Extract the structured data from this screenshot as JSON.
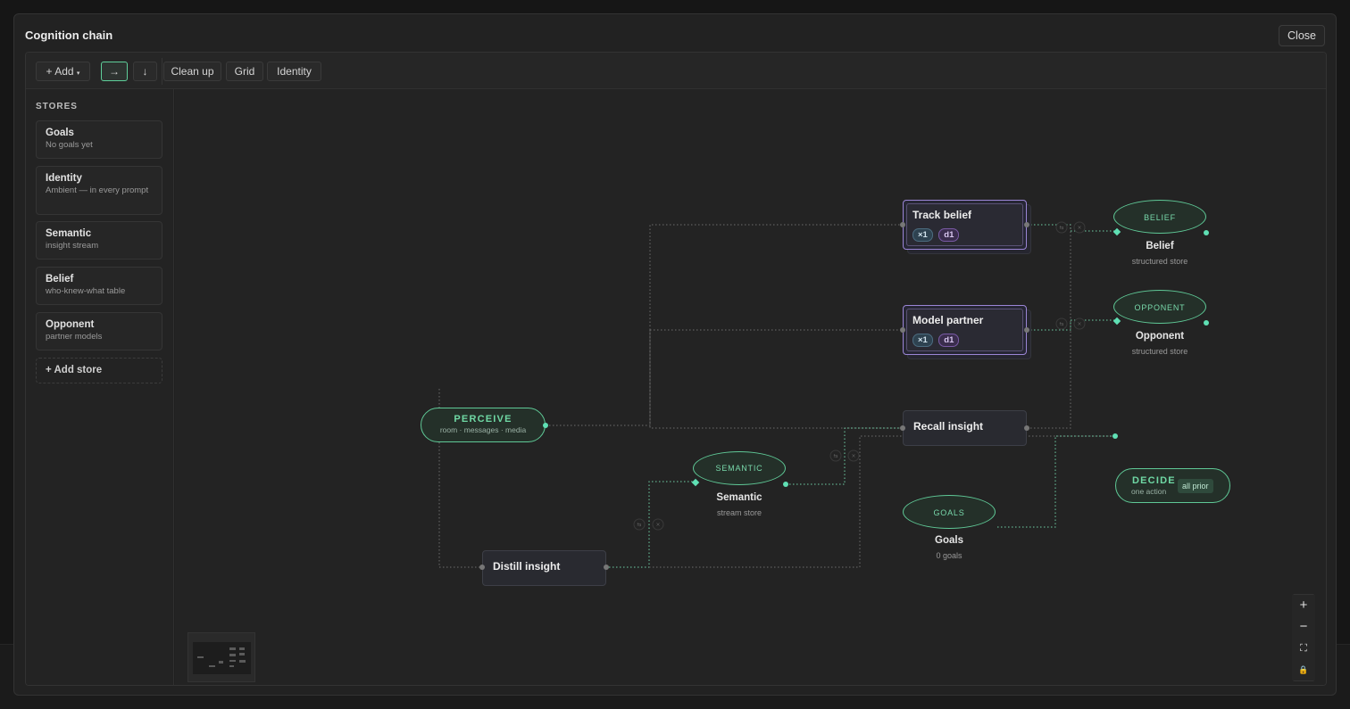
{
  "window": {
    "title": "Cognition chain",
    "close_label": "Close"
  },
  "toolbar": {
    "add_label": "+ Add",
    "add_caret": "▾",
    "dir_right": "→",
    "dir_down": "↓",
    "cleanup_label": "Clean up",
    "grid_label": "Grid",
    "identity_label": "Identity"
  },
  "sidebar": {
    "heading": "STORES",
    "stores": [
      {
        "name": "Goals",
        "sub": "No goals yet"
      },
      {
        "name": "Identity",
        "sub": "Ambient — in every prompt"
      },
      {
        "name": "Semantic",
        "sub": "insight stream"
      },
      {
        "name": "Belief",
        "sub": "who-knew-what table"
      },
      {
        "name": "Opponent",
        "sub": "partner models"
      }
    ],
    "add_store_label": "+ Add store"
  },
  "graph": {
    "perceive": {
      "title": "PERCEIVE",
      "sub": "room · messages · media"
    },
    "distill": {
      "title": "Distill insight"
    },
    "recall": {
      "title": "Recall insight"
    },
    "track_belief": {
      "title": "Track belief",
      "chip_x": "×1",
      "chip_d": "d1"
    },
    "model_partner": {
      "title": "Model partner",
      "chip_x": "×1",
      "chip_d": "d1"
    },
    "semantic": {
      "pill": "SEMANTIC",
      "name": "Semantic",
      "sub": "stream store"
    },
    "belief": {
      "pill": "BELIEF",
      "name": "Belief",
      "sub": "structured store"
    },
    "opponent": {
      "pill": "OPPONENT",
      "name": "Opponent",
      "sub": "structured store"
    },
    "goals": {
      "pill": "GOALS",
      "name": "Goals",
      "sub": "0 goals"
    },
    "decide": {
      "title": "DECIDE",
      "sub": "one action",
      "badge": "all prior"
    },
    "edge_swap_glyph": "⇆",
    "edge_remove_glyph": "×"
  },
  "zoom": {
    "in": "+",
    "out": "−",
    "fit": "⛶",
    "lock": "🔒"
  },
  "colors": {
    "accent_green": "#5fc896",
    "agent_purple": "#9b86d6",
    "port_mint": "#5fe0b4"
  }
}
